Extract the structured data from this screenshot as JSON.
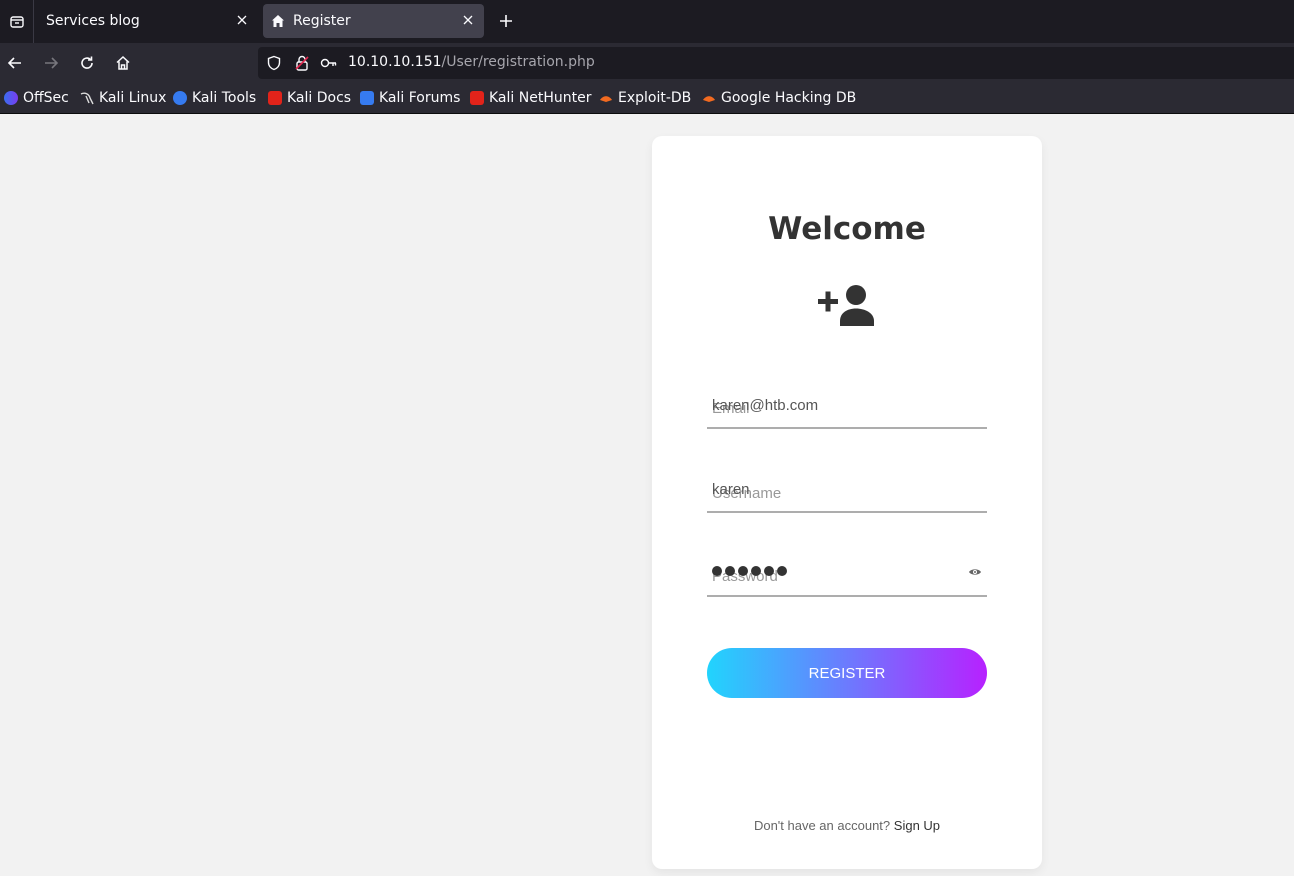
{
  "browser": {
    "tabs": [
      {
        "title": "Services blog",
        "active": false
      },
      {
        "title": "Register",
        "active": true
      }
    ],
    "url": {
      "host": "10.10.10.151",
      "path": "/User/registration.php"
    },
    "bookmarks": [
      {
        "label": "OffSec",
        "icon": "offsec-icon"
      },
      {
        "label": "Kali Linux",
        "icon": "kali-dragon-icon"
      },
      {
        "label": "Kali Tools",
        "icon": "kali-tools-icon"
      },
      {
        "label": "Kali Docs",
        "icon": "kali-docs-icon"
      },
      {
        "label": "Kali Forums",
        "icon": "kali-forums-icon"
      },
      {
        "label": "Kali NetHunter",
        "icon": "kali-nethunter-icon"
      },
      {
        "label": "Exploit-DB",
        "icon": "exploitdb-icon"
      },
      {
        "label": "Google Hacking DB",
        "icon": "ghdb-icon"
      }
    ]
  },
  "form": {
    "title": "Welcome",
    "icon": "user-plus-icon",
    "email": {
      "value": "karen@htb.com",
      "placeholder": "Email"
    },
    "username": {
      "value": "karen",
      "placeholder": "Username"
    },
    "password": {
      "masked_length": 6,
      "placeholder": "Password"
    },
    "register_label": "REGISTER",
    "footer_text": "Don't have an account?",
    "footer_link": "Sign Up"
  },
  "colors": {
    "gradient_start": "#21d4fd",
    "gradient_end": "#b721ff",
    "page_bg": "#f2f2f2"
  }
}
